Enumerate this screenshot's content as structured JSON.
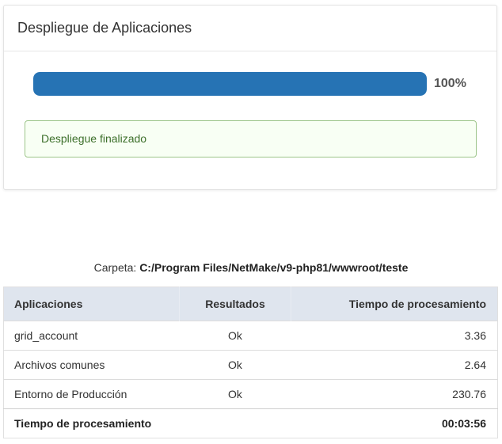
{
  "panel": {
    "title": "Despliegue de Aplicaciones",
    "progress_value": 100,
    "progress_label": "100%",
    "status_message": "Despliegue finalizado"
  },
  "folder": {
    "label": "Carpeta:",
    "path": "C:/Program Files/NetMake/v9-php81/wwwroot/teste"
  },
  "table": {
    "headers": [
      "Aplicaciones",
      "Resultados",
      "Tiempo de procesamiento"
    ],
    "rows": [
      [
        "grid_account",
        "Ok",
        "3.36"
      ],
      [
        "Archivos comunes",
        "Ok",
        "2.64"
      ],
      [
        "Entorno de Producción",
        "Ok",
        "230.76"
      ]
    ],
    "footer": {
      "label": "Tiempo de procesamiento",
      "value": "00:03:56"
    }
  },
  "colors": {
    "progress_fill": "#2673b4",
    "header_bg": "#dfe5ee",
    "alert_border": "#9dc58a",
    "alert_bg": "#f8fff4"
  }
}
